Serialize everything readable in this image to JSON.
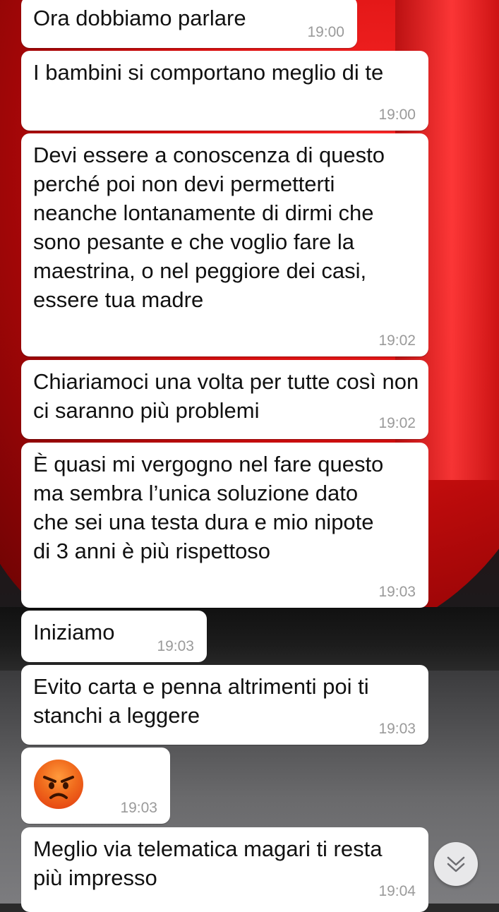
{
  "messages": [
    {
      "text": "Ora dobbiamo parlare",
      "time": "19:00"
    },
    {
      "text": "I bambini si comportano meglio di te",
      "time": "19:00"
    },
    {
      "text": "Devi essere a conoscenza di questo perché poi non devi permetterti neanche lontanamente di dirmi che sono pesante e che voglio fare la maestrina, o nel peggiore dei casi, essere tua madre",
      "time": "19:02"
    },
    {
      "text": "Chiariamoci una volta per tutte così non ci saranno più problemi",
      "time": "19:02"
    },
    {
      "text": "È quasi mi vergogno nel fare questo ma sembra l’unica soluzione dato che sei una testa dura e mio nipote di 3 anni è più rispettoso",
      "time": "19:03"
    },
    {
      "text": "Iniziamo",
      "time": "19:03"
    },
    {
      "text": "Evito carta e penna altrimenti poi ti stanchi a leggere",
      "time": "19:03"
    },
    {
      "emoji": "angry-face-emoji",
      "time": "19:03"
    },
    {
      "text": "Meglio via telematica magari ti resta più impresso",
      "time": "19:04"
    }
  ],
  "scroll_button": {
    "icon": "double-chevron-down-icon"
  },
  "colors": {
    "bubble": "#ffffff",
    "text": "#111111",
    "time": "#9a9a9a",
    "wallpaper_red": "#d81010"
  }
}
